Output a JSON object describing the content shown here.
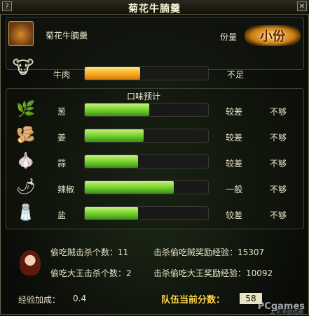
{
  "window": {
    "title": "菊花牛腩羹"
  },
  "dish": {
    "name": "菊花牛腩羹",
    "portion_label": "份量",
    "portion_value": "小份"
  },
  "main_ingredient": {
    "name": "牛肉",
    "fill": 0.45,
    "status": "不足",
    "icon": "beef-icon"
  },
  "taste_header": "口味预计",
  "taste_rows": [
    {
      "name": "葱",
      "fill": 0.52,
      "quality": "较差",
      "status": "不够",
      "icon": "scallion-icon"
    },
    {
      "name": "姜",
      "fill": 0.48,
      "quality": "较差",
      "status": "不够",
      "icon": "ginger-icon"
    },
    {
      "name": "蒜",
      "fill": 0.43,
      "quality": "较差",
      "status": "不够",
      "icon": "garlic-icon"
    },
    {
      "name": "辣椒",
      "fill": 0.72,
      "quality": "一般",
      "status": "不够",
      "icon": "chili-icon"
    },
    {
      "name": "盐",
      "fill": 0.43,
      "quality": "较差",
      "status": "不够",
      "icon": "salt-icon"
    }
  ],
  "stats": {
    "thief_kills": "偷吃贼击杀个数：11",
    "thief_exp": "击杀偷吃贼奖励经验：15307",
    "king_kills": "偷吃大王击杀个数：2",
    "king_exp": "击杀偷吃大王奖励经验：10092"
  },
  "footer": {
    "exp_bonus_label": "经验加成：",
    "exp_bonus_value": "0.4",
    "team_score_label": "队伍当前分数：",
    "team_score_value": "58"
  },
  "watermark": {
    "brand": "PCgames",
    "sub": "太平洋游戏网"
  },
  "colors": {
    "accent_orange": "#f5a419",
    "accent_green": "#6fcf2a",
    "frame": "#6b6a55"
  }
}
